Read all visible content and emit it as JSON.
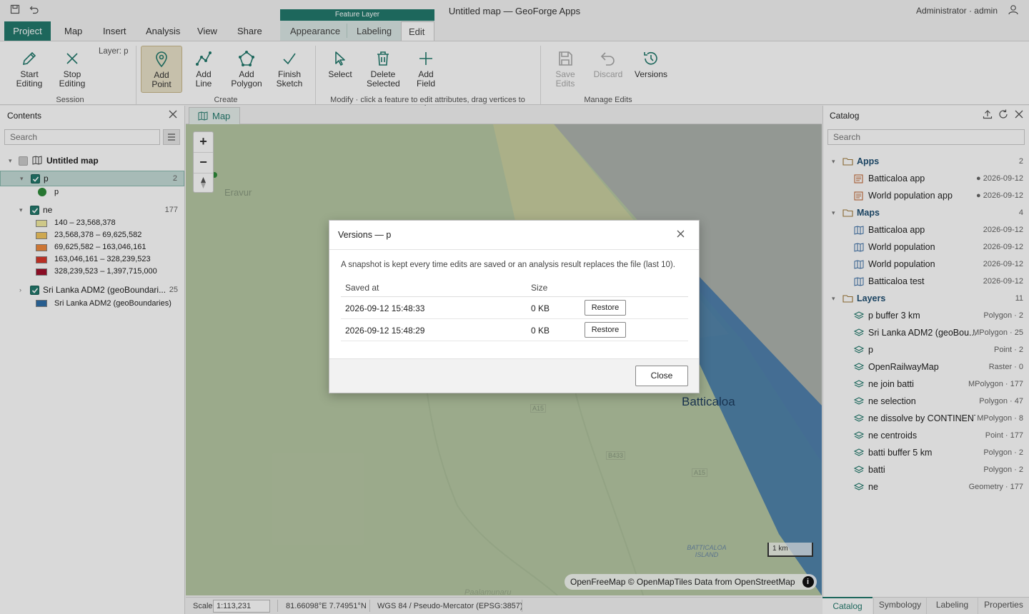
{
  "app": {
    "title": "Untitled map — GeoForge Apps",
    "user": "Administrator · admin"
  },
  "tabs": {
    "project": "Project",
    "map": "Map",
    "insert": "Insert",
    "analysis": "Analysis",
    "view": "View",
    "share": "Share",
    "context_header": "Feature Layer",
    "appearance": "Appearance",
    "labeling": "Labeling",
    "edit": "Edit"
  },
  "ribbon": {
    "layer_label": "Layer: p",
    "start_editing": "Start Editing",
    "stop_editing": "Stop Editing",
    "session_group": "Session",
    "add_point": "Add Point",
    "add_line": "Add Line",
    "add_polygon": "Add Polygon",
    "finish_sketch": "Finish Sketch",
    "create_group": "Create",
    "select": "Select",
    "delete_selected": "Delete Selected",
    "add_field": "Add Field",
    "modify_group": "Modify · click a feature to edit attributes, drag vertices to reshape",
    "save_edits": "Save Edits",
    "discard": "Discard",
    "versions": "Versions",
    "manage_group": "Manage Edits"
  },
  "contents": {
    "title": "Contents",
    "search_placeholder": "Search",
    "map_name": "Untitled map",
    "layers": [
      {
        "name": "p",
        "count": "2",
        "legend": [
          {
            "label": "p",
            "color": "#2e8b3a"
          }
        ]
      },
      {
        "name": "ne",
        "count": "177",
        "legend": [
          {
            "label": "140 – 23,568,378",
            "color": "#f2eba0"
          },
          {
            "label": "23,568,378 – 69,625,582",
            "color": "#f3c65e"
          },
          {
            "label": "69,625,582 – 163,046,161",
            "color": "#f08a3c"
          },
          {
            "label": "163,046,161 – 328,239,523",
            "color": "#d9382b"
          },
          {
            "label": "328,239,523 – 1,397,715,000",
            "color": "#a3102b"
          }
        ]
      },
      {
        "name": "Sri Lanka ADM2 (geoBoundari...",
        "count": "25",
        "legend": [
          {
            "label": "Sri Lanka ADM2 (geoBoundaries)",
            "color": "#2f6fa8"
          }
        ]
      }
    ]
  },
  "map": {
    "tab_label": "Map",
    "place_eravur": "Eravur",
    "place_batticaloa": "Batticaloa",
    "place_island": "BATTICALOA ISLAND",
    "road_a15": "A15",
    "road_b433": "B433",
    "road_a15b": "A15",
    "scale_bar": "1 km",
    "attribution": "OpenFreeMap © OpenMapTiles Data from OpenStreetMap",
    "partial_label": "Paalamunaru",
    "zoom_in": "+",
    "zoom_out": "−"
  },
  "dialog": {
    "title": "Versions — p",
    "description": "A snapshot is kept every time edits are saved or an analysis result replaces the file (last 10).",
    "col_saved_at": "Saved at",
    "col_size": "Size",
    "rows": [
      {
        "saved_at": "2026-09-12 15:48:33",
        "size": "0 KB",
        "action": "Restore"
      },
      {
        "saved_at": "2026-09-12 15:48:29",
        "size": "0 KB",
        "action": "Restore"
      }
    ],
    "close": "Close"
  },
  "catalog": {
    "title": "Catalog",
    "search_placeholder": "Search",
    "groups": [
      {
        "name": "Apps",
        "count": "2",
        "items": [
          {
            "name": "Batticaloa app",
            "meta": "● 2026-09-12"
          },
          {
            "name": "World population app",
            "meta": "● 2026-09-12"
          }
        ]
      },
      {
        "name": "Maps",
        "count": "4",
        "items": [
          {
            "name": "Batticaloa app",
            "meta": "2026-09-12"
          },
          {
            "name": "World population",
            "meta": "2026-09-12"
          },
          {
            "name": "World population",
            "meta": "2026-09-12"
          },
          {
            "name": "Batticaloa test",
            "meta": "2026-09-12"
          }
        ]
      },
      {
        "name": "Layers",
        "count": "11",
        "items": [
          {
            "name": "p buffer 3 km",
            "meta": "Polygon · 2"
          },
          {
            "name": "Sri Lanka ADM2 (geoBou...",
            "meta": "MPolygon · 25"
          },
          {
            "name": "p",
            "meta": "Point · 2"
          },
          {
            "name": "OpenRailwayMap",
            "meta": "Raster · 0"
          },
          {
            "name": "ne join batti",
            "meta": "MPolygon · 177"
          },
          {
            "name": "ne selection",
            "meta": "Polygon · 47"
          },
          {
            "name": "ne dissolve by CONTINENT",
            "meta": "MPolygon · 8"
          },
          {
            "name": "ne centroids",
            "meta": "Point · 177"
          },
          {
            "name": "batti buffer 5 km",
            "meta": "Polygon · 2"
          },
          {
            "name": "batti",
            "meta": "Polygon · 2"
          },
          {
            "name": "ne",
            "meta": "Geometry · 177"
          }
        ]
      }
    ]
  },
  "status": {
    "scale_label": "Scale",
    "scale_value": "1:113,231",
    "coords": "81.66098°E 7.74951°N",
    "crs": "WGS 84 / Pseudo-Mercator (EPSG:3857)"
  },
  "bottom_tabs": {
    "catalog": "Catalog",
    "symbology": "Symbology",
    "labeling": "Labeling",
    "properties": "Properties"
  }
}
